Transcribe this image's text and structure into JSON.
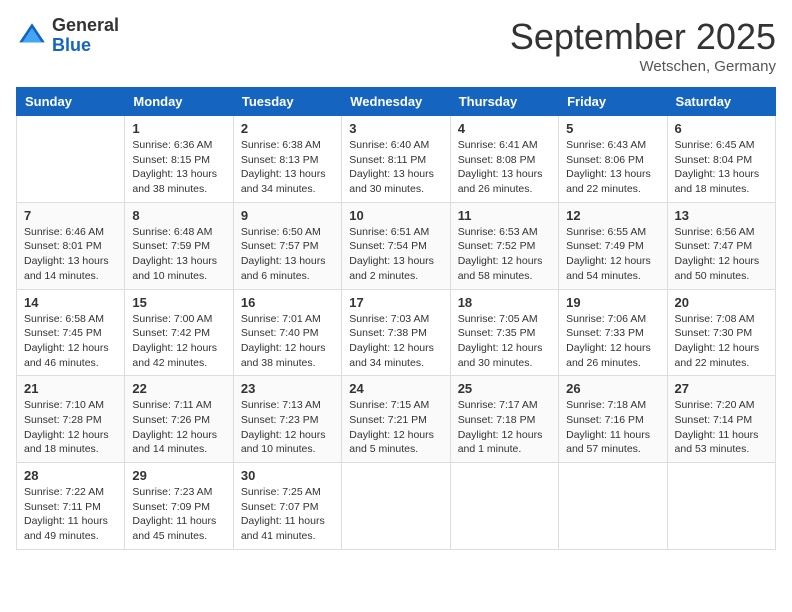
{
  "logo": {
    "general": "General",
    "blue": "Blue"
  },
  "title": {
    "month": "September 2025",
    "location": "Wetschen, Germany"
  },
  "calendar": {
    "headers": [
      "Sunday",
      "Monday",
      "Tuesday",
      "Wednesday",
      "Thursday",
      "Friday",
      "Saturday"
    ],
    "weeks": [
      [
        {
          "day": "",
          "info": ""
        },
        {
          "day": "1",
          "info": "Sunrise: 6:36 AM\nSunset: 8:15 PM\nDaylight: 13 hours\nand 38 minutes."
        },
        {
          "day": "2",
          "info": "Sunrise: 6:38 AM\nSunset: 8:13 PM\nDaylight: 13 hours\nand 34 minutes."
        },
        {
          "day": "3",
          "info": "Sunrise: 6:40 AM\nSunset: 8:11 PM\nDaylight: 13 hours\nand 30 minutes."
        },
        {
          "day": "4",
          "info": "Sunrise: 6:41 AM\nSunset: 8:08 PM\nDaylight: 13 hours\nand 26 minutes."
        },
        {
          "day": "5",
          "info": "Sunrise: 6:43 AM\nSunset: 8:06 PM\nDaylight: 13 hours\nand 22 minutes."
        },
        {
          "day": "6",
          "info": "Sunrise: 6:45 AM\nSunset: 8:04 PM\nDaylight: 13 hours\nand 18 minutes."
        }
      ],
      [
        {
          "day": "7",
          "info": "Sunrise: 6:46 AM\nSunset: 8:01 PM\nDaylight: 13 hours\nand 14 minutes."
        },
        {
          "day": "8",
          "info": "Sunrise: 6:48 AM\nSunset: 7:59 PM\nDaylight: 13 hours\nand 10 minutes."
        },
        {
          "day": "9",
          "info": "Sunrise: 6:50 AM\nSunset: 7:57 PM\nDaylight: 13 hours\nand 6 minutes."
        },
        {
          "day": "10",
          "info": "Sunrise: 6:51 AM\nSunset: 7:54 PM\nDaylight: 13 hours\nand 2 minutes."
        },
        {
          "day": "11",
          "info": "Sunrise: 6:53 AM\nSunset: 7:52 PM\nDaylight: 12 hours\nand 58 minutes."
        },
        {
          "day": "12",
          "info": "Sunrise: 6:55 AM\nSunset: 7:49 PM\nDaylight: 12 hours\nand 54 minutes."
        },
        {
          "day": "13",
          "info": "Sunrise: 6:56 AM\nSunset: 7:47 PM\nDaylight: 12 hours\nand 50 minutes."
        }
      ],
      [
        {
          "day": "14",
          "info": "Sunrise: 6:58 AM\nSunset: 7:45 PM\nDaylight: 12 hours\nand 46 minutes."
        },
        {
          "day": "15",
          "info": "Sunrise: 7:00 AM\nSunset: 7:42 PM\nDaylight: 12 hours\nand 42 minutes."
        },
        {
          "day": "16",
          "info": "Sunrise: 7:01 AM\nSunset: 7:40 PM\nDaylight: 12 hours\nand 38 minutes."
        },
        {
          "day": "17",
          "info": "Sunrise: 7:03 AM\nSunset: 7:38 PM\nDaylight: 12 hours\nand 34 minutes."
        },
        {
          "day": "18",
          "info": "Sunrise: 7:05 AM\nSunset: 7:35 PM\nDaylight: 12 hours\nand 30 minutes."
        },
        {
          "day": "19",
          "info": "Sunrise: 7:06 AM\nSunset: 7:33 PM\nDaylight: 12 hours\nand 26 minutes."
        },
        {
          "day": "20",
          "info": "Sunrise: 7:08 AM\nSunset: 7:30 PM\nDaylight: 12 hours\nand 22 minutes."
        }
      ],
      [
        {
          "day": "21",
          "info": "Sunrise: 7:10 AM\nSunset: 7:28 PM\nDaylight: 12 hours\nand 18 minutes."
        },
        {
          "day": "22",
          "info": "Sunrise: 7:11 AM\nSunset: 7:26 PM\nDaylight: 12 hours\nand 14 minutes."
        },
        {
          "day": "23",
          "info": "Sunrise: 7:13 AM\nSunset: 7:23 PM\nDaylight: 12 hours\nand 10 minutes."
        },
        {
          "day": "24",
          "info": "Sunrise: 7:15 AM\nSunset: 7:21 PM\nDaylight: 12 hours\nand 5 minutes."
        },
        {
          "day": "25",
          "info": "Sunrise: 7:17 AM\nSunset: 7:18 PM\nDaylight: 12 hours\nand 1 minute."
        },
        {
          "day": "26",
          "info": "Sunrise: 7:18 AM\nSunset: 7:16 PM\nDaylight: 11 hours\nand 57 minutes."
        },
        {
          "day": "27",
          "info": "Sunrise: 7:20 AM\nSunset: 7:14 PM\nDaylight: 11 hours\nand 53 minutes."
        }
      ],
      [
        {
          "day": "28",
          "info": "Sunrise: 7:22 AM\nSunset: 7:11 PM\nDaylight: 11 hours\nand 49 minutes."
        },
        {
          "day": "29",
          "info": "Sunrise: 7:23 AM\nSunset: 7:09 PM\nDaylight: 11 hours\nand 45 minutes."
        },
        {
          "day": "30",
          "info": "Sunrise: 7:25 AM\nSunset: 7:07 PM\nDaylight: 11 hours\nand 41 minutes."
        },
        {
          "day": "",
          "info": ""
        },
        {
          "day": "",
          "info": ""
        },
        {
          "day": "",
          "info": ""
        },
        {
          "day": "",
          "info": ""
        }
      ]
    ]
  }
}
